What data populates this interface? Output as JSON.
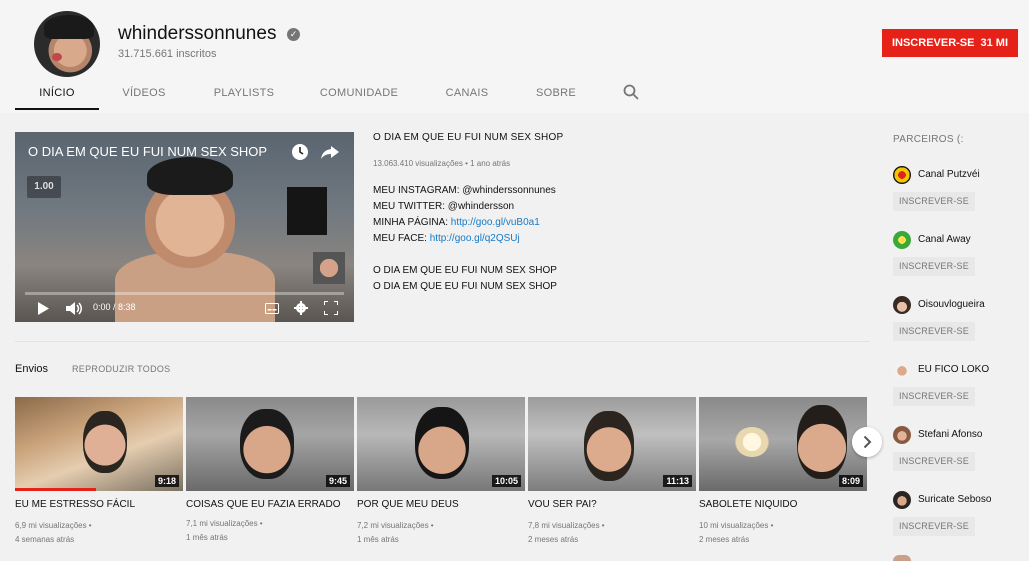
{
  "channel": {
    "name": "whinderssonnunes",
    "subscribers": "31.715.661 inscritos",
    "subscribe_label": "INSCREVER-SE",
    "subscribe_count": "31 MI"
  },
  "tabs": [
    {
      "label": "INÍCIO",
      "active": true
    },
    {
      "label": "VÍDEOS",
      "active": false
    },
    {
      "label": "PLAYLISTS",
      "active": false
    },
    {
      "label": "COMUNIDADE",
      "active": false
    },
    {
      "label": "CANAIS",
      "active": false
    },
    {
      "label": "SOBRE",
      "active": false
    }
  ],
  "player": {
    "title": "O DIA EM QUE EU FUI NUM SEX SHOP",
    "speed": "1.00",
    "time": "0:00 / 8:38"
  },
  "featured": {
    "title": "O DIA EM QUE EU FUI NUM SEX SHOP",
    "meta": "13.063.410 visualizações • 1 ano atrás",
    "desc": {
      "instagram": "MEU INSTAGRAM: @whinderssonnunes",
      "twitter": "MEU TWITTER: @whindersson",
      "page_prefix": "MINHA PÁGINA: ",
      "page_link": "http://goo.gl/vuB0a1",
      "face_prefix": "MEU FACE: ",
      "face_link": "http://goo.gl/q2QSUj",
      "line1": "O DIA EM QUE EU FUI NUM SEX SHOP",
      "line2": "O DIA EM QUE EU FUI NUM SEX SHOP"
    }
  },
  "uploads": {
    "title": "Envios",
    "play_all": "REPRODUZIR TODOS",
    "videos": [
      {
        "title": "EU ME ESTRESSO FÁCIL",
        "duration": "9:18",
        "views": "6,9 mi visualizações •",
        "age": "4 semanas atrás",
        "watched": 0.48
      },
      {
        "title": "COISAS QUE EU FAZIA ERRADO",
        "duration": "9:45",
        "views": "7,1 mi visualizações •",
        "age": "1 mês atrás",
        "watched": 0
      },
      {
        "title": "POR QUE MEU DEUS",
        "duration": "10:05",
        "views": "7,2 mi visualizações •",
        "age": "1 mês atrás",
        "watched": 0
      },
      {
        "title": "VOU SER PAI?",
        "duration": "11:13",
        "views": "7,8 mi visualizações •",
        "age": "2 meses atrás",
        "watched": 0
      },
      {
        "title": "SABOLETE NIQUIDO",
        "duration": "8:09",
        "views": "10 mi visualizações •",
        "age": "2 meses atrás",
        "watched": 0
      }
    ]
  },
  "sidebar": {
    "title": "PARCEIROS (:",
    "subscribe_label": "INSCREVER-SE",
    "partners": [
      {
        "name": "Canal Putzvéi"
      },
      {
        "name": "Canal Away"
      },
      {
        "name": "Oisouvlogueira"
      },
      {
        "name": "EU FICO LOKO"
      },
      {
        "name": "Stefani Afonso"
      },
      {
        "name": "Suricate Seboso"
      }
    ]
  },
  "colors": {
    "accent_red": "#e62117",
    "link_blue": "#167ac6"
  }
}
